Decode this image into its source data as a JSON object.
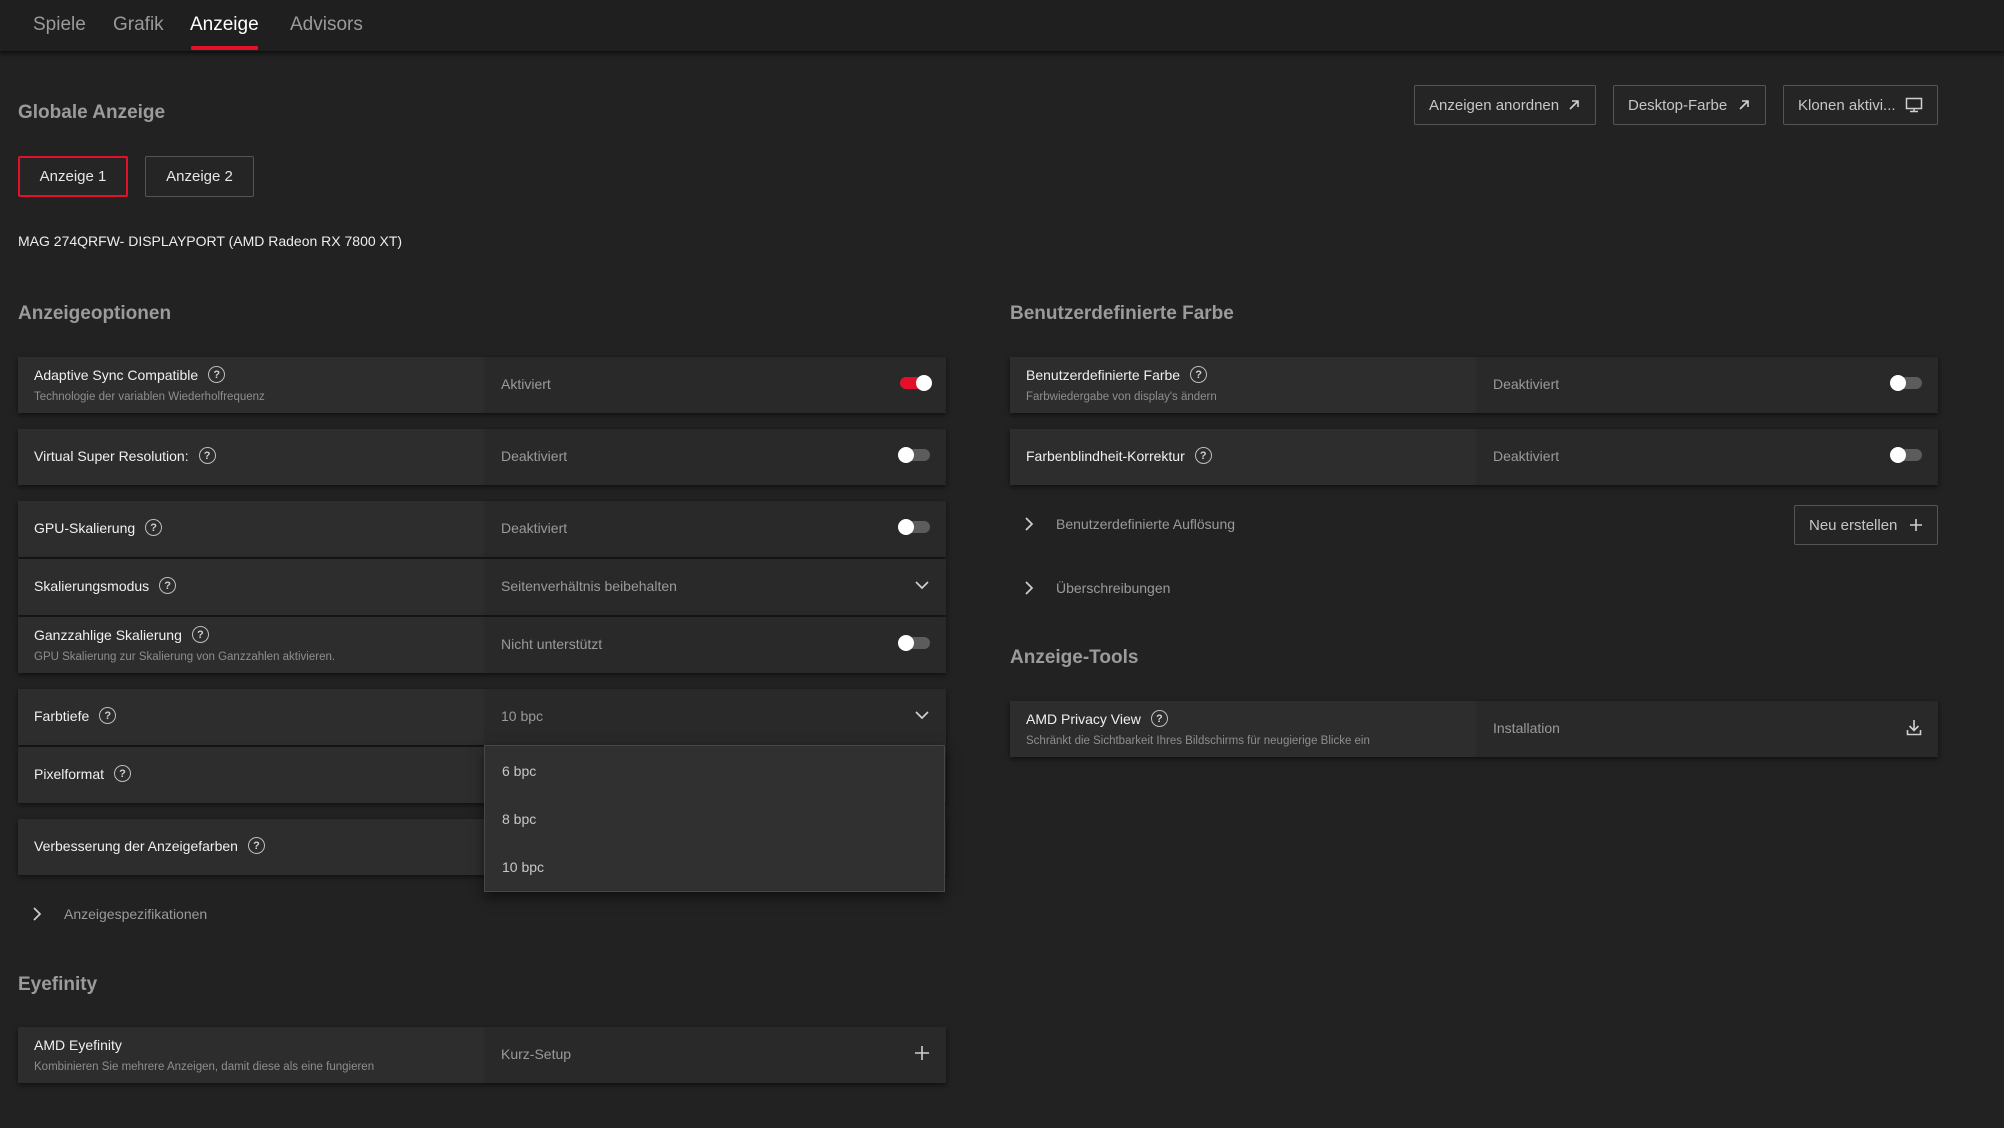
{
  "nav": {
    "tabs": [
      "Spiele",
      "Grafik",
      "Anzeige",
      "Advisors"
    ],
    "active": "Anzeige"
  },
  "global": {
    "title": "Globale Anzeige",
    "actions": {
      "arrange": "Anzeigen anordnen",
      "desktop_color": "Desktop-Farbe",
      "clone": "Klonen aktivi..."
    },
    "displays": [
      "Anzeige 1",
      "Anzeige 2"
    ],
    "monitor": "MAG 274QRFW- DISPLAYPORT (AMD Radeon RX 7800 XT)"
  },
  "options": {
    "title": "Anzeigeoptionen",
    "adaptive_sync": {
      "label": "Adaptive Sync Compatible",
      "sub": "Technologie der variablen Wiederholfrequenz",
      "value": "Aktiviert",
      "on": true
    },
    "vsr": {
      "label": "Virtual Super Resolution:",
      "value": "Deaktiviert",
      "on": false
    },
    "gpu_scaling": {
      "label": "GPU-Skalierung",
      "value": "Deaktiviert",
      "on": false
    },
    "scaling_mode": {
      "label": "Skalierungsmodus",
      "value": "Seitenverhältnis beibehalten"
    },
    "integer_scaling": {
      "label": "Ganzzahlige Skalierung",
      "sub": "GPU Skalierung zur Skalierung von Ganzzahlen aktivieren.",
      "value": "Nicht unterstützt",
      "on": false
    },
    "color_depth": {
      "label": "Farbtiefe",
      "value": "10 bpc",
      "options": [
        "6 bpc",
        "8 bpc",
        "10 bpc"
      ]
    },
    "pixel_format": {
      "label": "Pixelformat"
    },
    "color_enhancement": {
      "label": "Verbesserung der Anzeigefarben"
    },
    "specs": "Anzeigespezifikationen"
  },
  "eyefinity": {
    "title": "Eyefinity",
    "label": "AMD Eyefinity",
    "sub": "Kombinieren Sie mehrere Anzeigen, damit diese als eine fungieren",
    "value": "Kurz-Setup"
  },
  "custom_color": {
    "title": "Benutzerdefinierte Farbe",
    "custom": {
      "label": "Benutzerdefinierte Farbe",
      "sub": "Farbwiedergabe von display's ändern",
      "value": "Deaktiviert",
      "on": false
    },
    "colorblind": {
      "label": "Farbenblindheit-Korrektur",
      "value": "Deaktiviert",
      "on": false
    },
    "custom_res": "Benutzerdefinierte Auflösung",
    "new_button": "Neu erstellen",
    "overrides": "Überschreibungen"
  },
  "tools": {
    "title": "Anzeige-Tools",
    "privacy": {
      "label": "AMD Privacy View",
      "sub": "Schränkt die Sichtbarkeit Ihres Bildschirms für neugierige Blicke ein",
      "value": "Installation"
    }
  },
  "colors": {
    "accent": "#e4102a",
    "background": "#222222",
    "panel": "#2c2c2c"
  }
}
